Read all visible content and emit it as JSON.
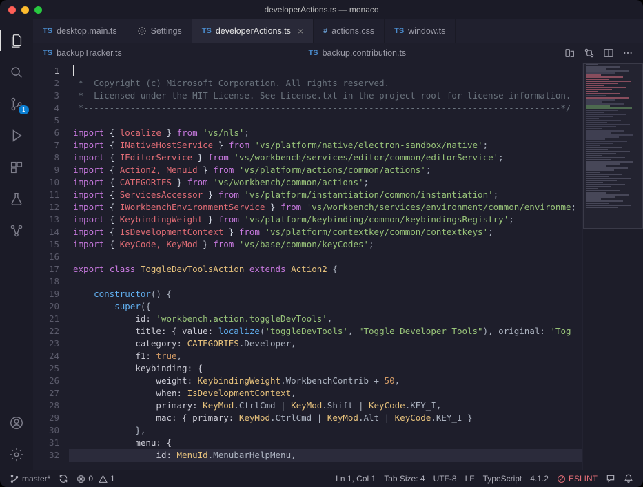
{
  "title": "developerActions.ts — monaco",
  "activitybar": {
    "scm_badge": "1"
  },
  "tabs_row1": [
    {
      "icon": "ts",
      "label": "desktop.main.ts",
      "active": false
    },
    {
      "icon": "gear",
      "label": "Settings",
      "active": false
    },
    {
      "icon": "ts",
      "label": "developerActions.ts",
      "active": true,
      "close": true
    },
    {
      "icon": "css",
      "label": "actions.css",
      "active": false
    },
    {
      "icon": "ts",
      "label": "window.ts",
      "active": false
    }
  ],
  "tabs_row2": [
    {
      "icon": "ts",
      "label": "backupTracker.ts"
    },
    {
      "icon": "ts",
      "label": "backup.contribution.ts"
    }
  ],
  "gutter": {
    "start": 1,
    "end": 32,
    "current": 1
  },
  "code": {
    "lines": [
      {
        "type": "cursor",
        "text": ""
      },
      {
        "type": "comment",
        "text": " *  Copyright (c) Microsoft Corporation. All rights reserved."
      },
      {
        "type": "comment",
        "text": " *  Licensed under the MIT License. See License.txt in the project root for license information."
      },
      {
        "type": "comment",
        "text": " *--------------------------------------------------------------------------------------------*/"
      },
      {
        "type": "blank",
        "text": ""
      },
      {
        "type": "import",
        "ident": "localize",
        "path": "'vs/nls'"
      },
      {
        "type": "import",
        "ident": "INativeHostService",
        "path": "'vs/platform/native/electron-sandbox/native'"
      },
      {
        "type": "import",
        "ident": "IEditorService",
        "path": "'vs/workbench/services/editor/common/editorService'"
      },
      {
        "type": "import",
        "ident": "Action2, MenuId",
        "path": "'vs/platform/actions/common/actions'"
      },
      {
        "type": "import",
        "ident": "CATEGORIES",
        "path": "'vs/workbench/common/actions'"
      },
      {
        "type": "import",
        "ident": "ServicesAccessor",
        "path": "'vs/platform/instantiation/common/instantiation'"
      },
      {
        "type": "import",
        "ident": "IWorkbenchEnvironmentService",
        "path": "'vs/workbench/services/environment/common/environme"
      },
      {
        "type": "import",
        "ident": "KeybindingWeight",
        "path": "'vs/platform/keybinding/common/keybindingsRegistry'"
      },
      {
        "type": "import",
        "ident": "IsDevelopmentContext",
        "path": "'vs/platform/contextkey/common/contextkeys'"
      },
      {
        "type": "import",
        "ident": "KeyCode, KeyMod",
        "path": "'vs/base/common/keyCodes'"
      },
      {
        "type": "blank",
        "text": ""
      },
      {
        "type": "classdecl",
        "name": "ToggleDevToolsAction",
        "ext": "Action2"
      },
      {
        "type": "blank",
        "text": ""
      },
      {
        "type": "raw",
        "html": "    <span class='tk-func'>constructor</span><span class='tk-punc'>() {</span>"
      },
      {
        "type": "raw",
        "html": "        <span class='tk-func'>super</span><span class='tk-punc'>({</span>"
      },
      {
        "type": "raw",
        "html": "            <span class='tk-text'>id: </span><span class='tk-string'>'workbench.action.toggleDevTools'</span><span class='tk-punc'>,</span>"
      },
      {
        "type": "raw",
        "html": "            <span class='tk-text'>title: { value: </span><span class='tk-func'>localize</span><span class='tk-punc'>(</span><span class='tk-string'>'toggleDevTools'</span><span class='tk-punc'>, </span><span class='tk-string'>\"Toggle Developer Tools\"</span><span class='tk-punc'>), original: </span><span class='tk-string'>'Tog</span>"
      },
      {
        "type": "raw",
        "html": "            <span class='tk-text'>category: </span><span class='tk-ident2'>CATEGORIES</span><span class='tk-punc'>.Developer,</span>"
      },
      {
        "type": "raw",
        "html": "            <span class='tk-text'>f1: </span><span class='tk-bool'>true</span><span class='tk-punc'>,</span>"
      },
      {
        "type": "raw",
        "html": "            <span class='tk-text'>keybinding: {</span>"
      },
      {
        "type": "raw",
        "html": "                <span class='tk-text'>weight: </span><span class='tk-ident2'>KeybindingWeight</span><span class='tk-punc'>.WorkbenchContrib + </span><span class='tk-num'>50</span><span class='tk-punc'>,</span>"
      },
      {
        "type": "raw",
        "html": "                <span class='tk-text'>when: </span><span class='tk-ident2'>IsDevelopmentContext</span><span class='tk-punc'>,</span>"
      },
      {
        "type": "raw",
        "html": "                <span class='tk-text'>primary: </span><span class='tk-ident2'>KeyMod</span><span class='tk-punc'>.CtrlCmd | </span><span class='tk-ident2'>KeyMod</span><span class='tk-punc'>.Shift | </span><span class='tk-ident2'>KeyCode</span><span class='tk-punc'>.KEY_I,</span>"
      },
      {
        "type": "raw",
        "html": "                <span class='tk-text'>mac: { primary: </span><span class='tk-ident2'>KeyMod</span><span class='tk-punc'>.CtrlCmd | </span><span class='tk-ident2'>KeyMod</span><span class='tk-punc'>.Alt | </span><span class='tk-ident2'>KeyCode</span><span class='tk-punc'>.KEY_I }</span>"
      },
      {
        "type": "raw",
        "html": "            <span class='tk-punc'>},</span>"
      },
      {
        "type": "raw",
        "html": "            <span class='tk-text'>menu: {</span>"
      },
      {
        "type": "raw",
        "hl": true,
        "html": "                <span class='tk-text'>id: </span><span class='tk-ident2'>MenuId</span><span class='tk-punc'>.MenubarHelpMenu,</span>"
      }
    ]
  },
  "statusbar": {
    "branch": "master*",
    "errors": "0",
    "warnings": "1",
    "cursor": "Ln 1, Col 1",
    "tabsize": "Tab Size: 4",
    "encoding": "UTF-8",
    "eol": "LF",
    "lang": "TypeScript",
    "version": "4.1.2",
    "eslint": "ESLINT"
  }
}
